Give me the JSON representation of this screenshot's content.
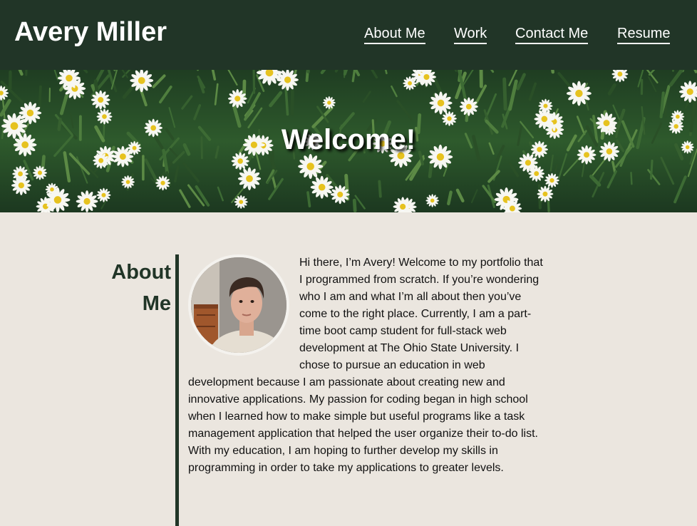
{
  "header": {
    "title": "Avery Miller",
    "nav": [
      {
        "label": "About Me"
      },
      {
        "label": "Work"
      },
      {
        "label": "Contact Me"
      },
      {
        "label": "Resume"
      }
    ]
  },
  "hero": {
    "heading": "Welcome!",
    "image": "daisy-field-photo"
  },
  "about": {
    "heading": "About Me",
    "avatar": "profile-photo",
    "text": "Hi there, I’m Avery! Welcome to my portfolio that I programmed from scratch. If you’re wondering who I am and what I’m all about then you’ve come to the right place. Currently, I am a part-time boot camp student for full-stack web development at The Ohio State University. I chose to pursue an education in web development because I am passionate about creating new and innovative applications. My passion for coding began in high school when I learned how to make simple but useful programs like a task management application that helped the user organize their to-do list. With my education, I am hoping to further develop my skills in programming in order to take my applications to greater levels."
  },
  "colors": {
    "header_bg": "#213527",
    "page_bg": "#ebe6df",
    "accent": "#213527"
  }
}
